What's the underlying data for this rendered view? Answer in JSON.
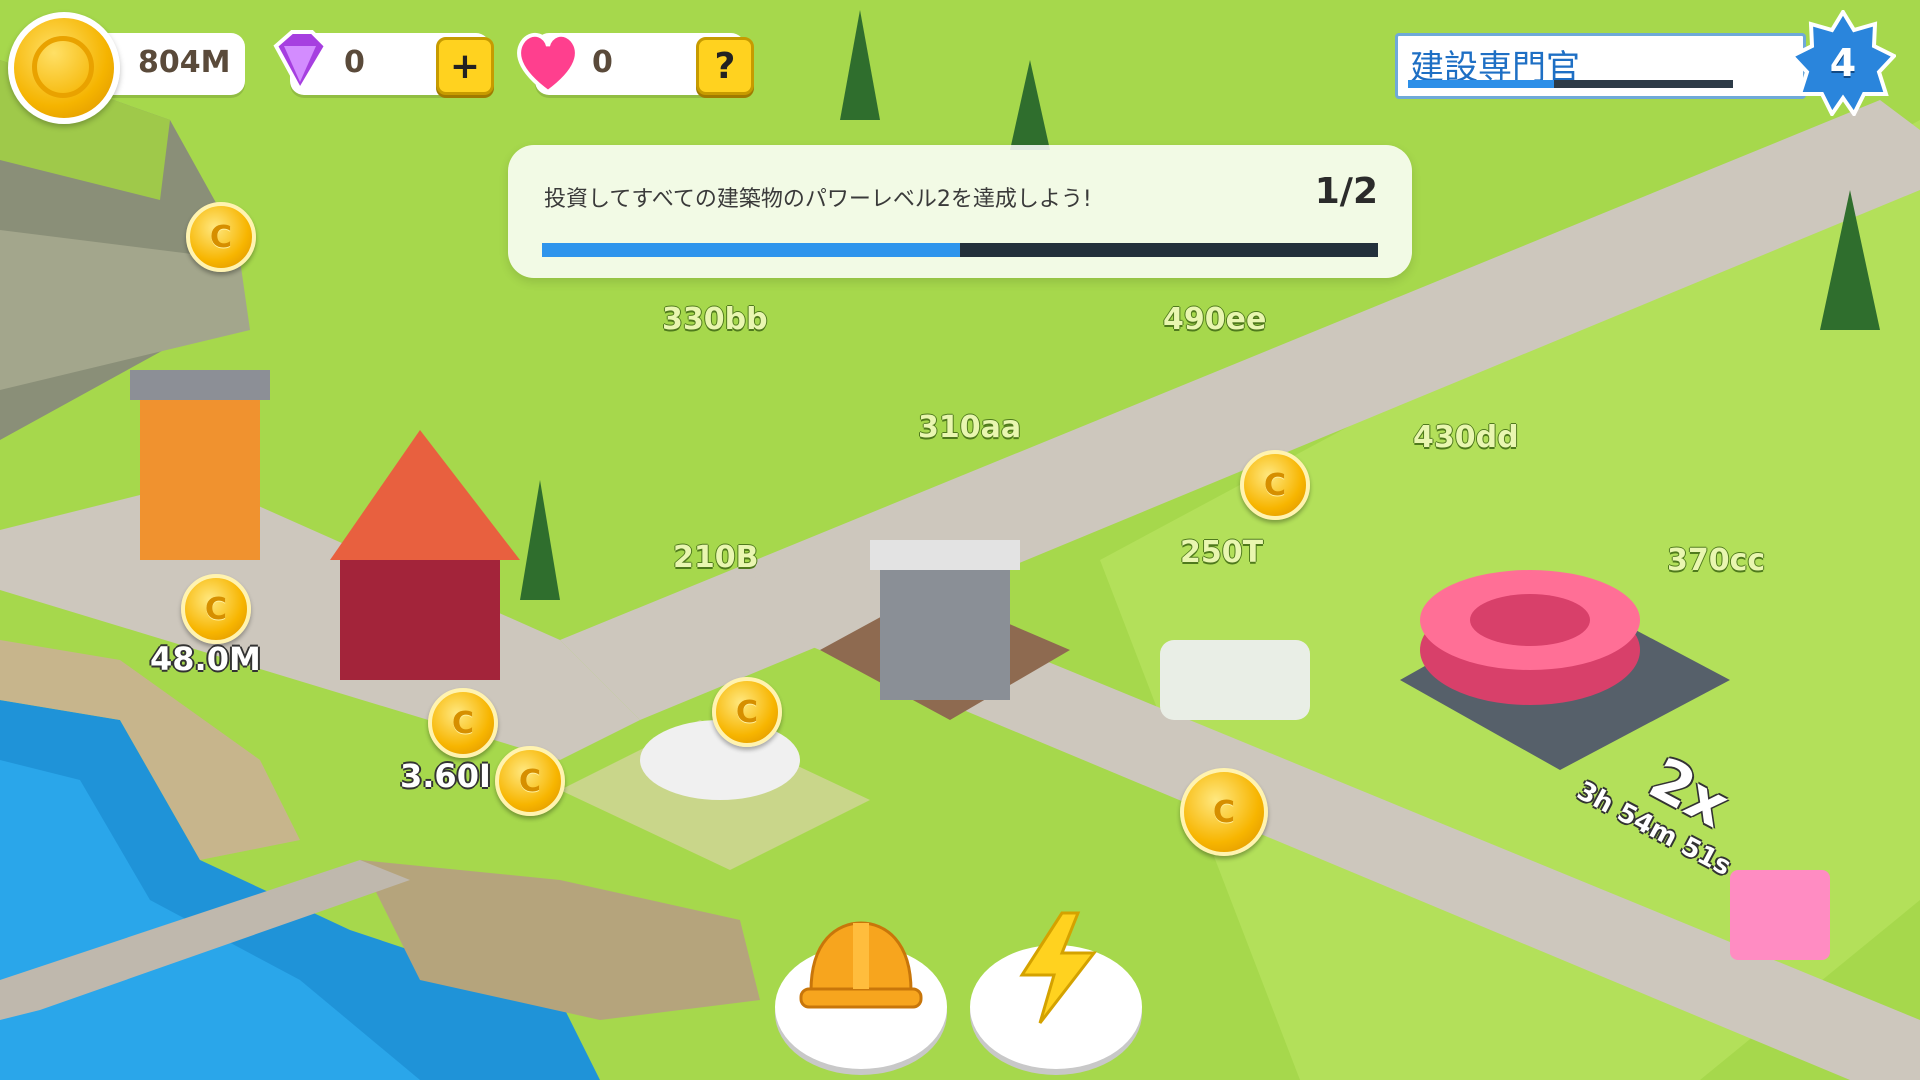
{
  "hud": {
    "coins": "804M",
    "gems": "0",
    "hearts": "0",
    "gem_plus_label": "+",
    "help_label": "?",
    "coin_icon": "coin-icon",
    "gem_icon": "gem-icon",
    "heart_icon": "heart-icon"
  },
  "rank": {
    "title": "建設専門官",
    "level": "4",
    "progress": 0.45
  },
  "quest": {
    "text": "投資してすべての建築物のパワーレベル2を達成しよう!",
    "count": "1/2",
    "progress": 0.5
  },
  "plots": [
    {
      "name": "plot-330bb",
      "label": "330bb"
    },
    {
      "name": "plot-490ee",
      "label": "490ee"
    },
    {
      "name": "plot-310aa",
      "label": "310aa"
    },
    {
      "name": "plot-430dd",
      "label": "430dd"
    },
    {
      "name": "plot-210b",
      "label": "210B"
    },
    {
      "name": "plot-250t",
      "label": "250T"
    },
    {
      "name": "plot-370cc",
      "label": "370cc"
    }
  ],
  "incomes": [
    "48.0M",
    "3.60I"
  ],
  "coin_glyph": "C",
  "boost": {
    "multiplier": "2x",
    "timer": "3h 54m 51s"
  },
  "actions": {
    "build_icon": "hard-hat-icon",
    "boost_icon": "lightning-icon"
  },
  "colors": {
    "accent": "#2e94ec",
    "coin": "#f5b400",
    "gem": "#b04be8",
    "heart": "#ff3f8e",
    "grass": "#9fd44a",
    "road": "#cdc7bd",
    "water": "#1f93d8"
  }
}
